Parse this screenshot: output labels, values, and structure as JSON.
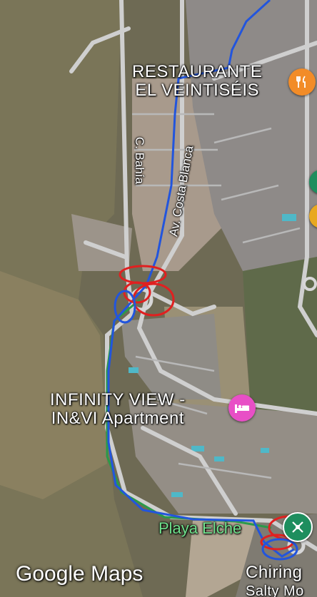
{
  "map": {
    "type": "satellite",
    "roads": {
      "bahia": "C. Bahía",
      "costa_blanca": "Av. Costa Blanca"
    },
    "pois": {
      "restaurant": {
        "lines": [
          "RESTAURANTE",
          "EL VEINTISÉIS"
        ],
        "icon": "fork-knife-icon",
        "color": "#f28c28"
      },
      "apartment": {
        "lines": [
          "INFINITY VIEW -",
          "IN&VI Apartment"
        ],
        "icon": "bed-icon",
        "color": "#e84fc6"
      },
      "beach": {
        "label": "Playa Elche",
        "icon": "beach-icon",
        "color": "#1e8e5e"
      },
      "chiringuito": {
        "lines": [
          "Chiring",
          "Salty Mo"
        ]
      }
    },
    "edge_pins": [
      {
        "icon": "green-pin-icon",
        "color": "#1e8e5e"
      },
      {
        "icon": "yellow-pin-icon",
        "color": "#e8a820"
      }
    ],
    "annotations": {
      "route_color": "#2255dd",
      "route_alt_color": "#2a9a4a",
      "circle_color": "#e02020"
    }
  },
  "branding": "Google Maps"
}
